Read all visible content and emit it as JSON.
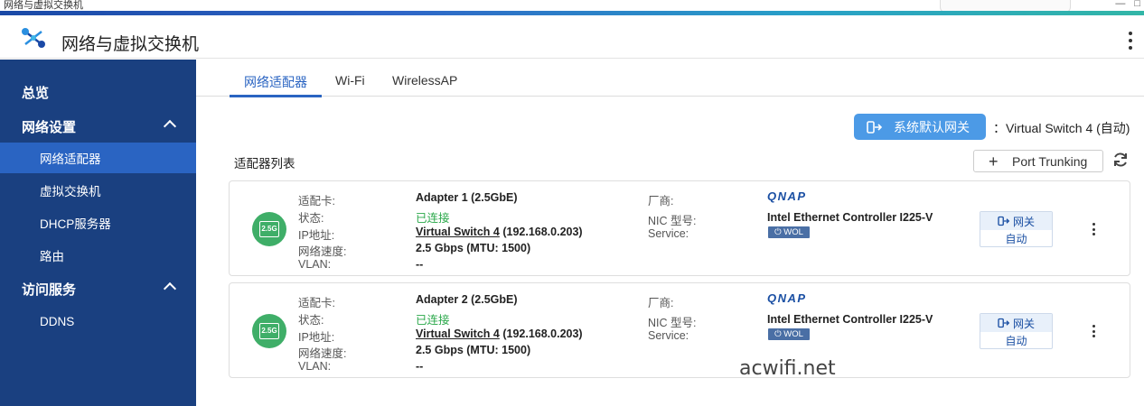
{
  "window": {
    "title": "网络与虚拟交换机"
  },
  "header": {
    "title": "网络与虚拟交换机"
  },
  "sidebar": {
    "items": [
      {
        "label": "总览"
      },
      {
        "label": "网络设置"
      },
      {
        "label": "网络适配器"
      },
      {
        "label": "虚拟交换机"
      },
      {
        "label": "DHCP服务器"
      },
      {
        "label": "路由"
      },
      {
        "label": "访问服务"
      },
      {
        "label": "DDNS"
      }
    ]
  },
  "tabs": [
    {
      "label": "网络适配器"
    },
    {
      "label": "Wi-Fi"
    },
    {
      "label": "WirelessAP"
    }
  ],
  "gateway": {
    "button_label": "系统默认网关",
    "status": "：Virtual Switch 4 (自动)"
  },
  "list": {
    "title": "适配器列表",
    "port_trunking_label": "Port Trunking"
  },
  "labels": {
    "card": "适配卡:",
    "status": "状态:",
    "ip": "IP地址:",
    "speed": "网络速度:",
    "vlan": "VLAN:",
    "vendor": "厂商:",
    "nic_model": "NIC 型号:",
    "service": "Service:"
  },
  "adapters": [
    {
      "port_label": "2.5G",
      "name": "Adapter 1 (2.5GbE)",
      "status": "已连接",
      "ip_link": "Virtual Switch 4",
      "ip_addr": " (192.168.0.203)",
      "speed": "2.5 Gbps (MTU: 1500)",
      "vlan": "--",
      "vendor": "QNAP",
      "nic_model": "Intel Ethernet Controller I225-V",
      "service": "WOL",
      "gateway_label": "网关",
      "gateway_mode": "自动"
    },
    {
      "port_label": "2.5G",
      "name": "Adapter 2 (2.5GbE)",
      "status": "已连接",
      "ip_link": "Virtual Switch 4",
      "ip_addr": " (192.168.0.203)",
      "speed": "2.5 Gbps (MTU: 1500)",
      "vlan": "--",
      "vendor": "QNAP",
      "nic_model": "Intel Ethernet Controller I225-V",
      "service": "WOL",
      "gateway_label": "网关",
      "gateway_mode": "自动"
    }
  ],
  "watermark": "acwifi.net",
  "colors": {
    "sidebar": "#1a4080",
    "active": "#2a64c2",
    "gateway_btn": "#4c9ae6",
    "connected": "#2aa84a",
    "port_icon": "#3fae68"
  }
}
